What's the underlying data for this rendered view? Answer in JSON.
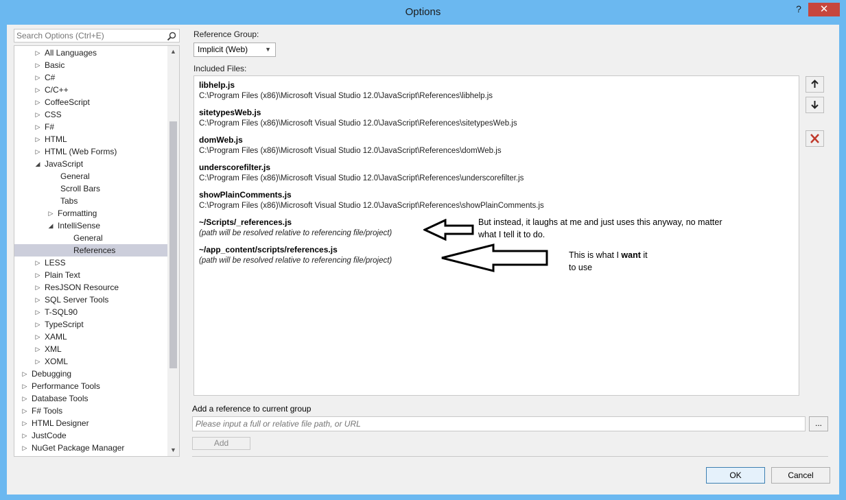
{
  "window": {
    "title": "Options",
    "help_label": "?",
    "close_label": "✕"
  },
  "search": {
    "placeholder": "Search Options (Ctrl+E)"
  },
  "tree": {
    "items": [
      {
        "label": "All Languages",
        "caret": "right"
      },
      {
        "label": "Basic",
        "caret": "right"
      },
      {
        "label": "C#",
        "caret": "right"
      },
      {
        "label": "C/C++",
        "caret": "right"
      },
      {
        "label": "CoffeeScript",
        "caret": "right"
      },
      {
        "label": "CSS",
        "caret": "right"
      },
      {
        "label": "F#",
        "caret": "right"
      },
      {
        "label": "HTML",
        "caret": "right"
      },
      {
        "label": "HTML (Web Forms)",
        "caret": "right"
      },
      {
        "label": "JavaScript",
        "caret": "down"
      },
      {
        "label": "General",
        "caret": "none"
      },
      {
        "label": "Scroll Bars",
        "caret": "none"
      },
      {
        "label": "Tabs",
        "caret": "none"
      },
      {
        "label": "Formatting",
        "caret": "right"
      },
      {
        "label": "IntelliSense",
        "caret": "down"
      },
      {
        "label": "General",
        "caret": "none"
      },
      {
        "label": "References",
        "caret": "none",
        "selected": true
      },
      {
        "label": "LESS",
        "caret": "right"
      },
      {
        "label": "Plain Text",
        "caret": "right"
      },
      {
        "label": "ResJSON Resource",
        "caret": "right"
      },
      {
        "label": "SQL Server Tools",
        "caret": "right"
      },
      {
        "label": "T-SQL90",
        "caret": "right"
      },
      {
        "label": "TypeScript",
        "caret": "right"
      },
      {
        "label": "XAML",
        "caret": "right"
      },
      {
        "label": "XML",
        "caret": "right"
      },
      {
        "label": "XOML",
        "caret": "right"
      },
      {
        "label": "Debugging",
        "caret": "right"
      },
      {
        "label": "Performance Tools",
        "caret": "right"
      },
      {
        "label": "Database Tools",
        "caret": "right"
      },
      {
        "label": "F# Tools",
        "caret": "right"
      },
      {
        "label": "HTML Designer",
        "caret": "right"
      },
      {
        "label": "JustCode",
        "caret": "right"
      },
      {
        "label": "NuGet Package Manager",
        "caret": "right"
      }
    ]
  },
  "reference_group": {
    "label": "Reference Group:",
    "value": "Implicit (Web)"
  },
  "included_files": {
    "label": "Included Files:",
    "files": [
      {
        "name": "libhelp.js",
        "path": "C:\\Program Files (x86)\\Microsoft Visual Studio 12.0\\JavaScript\\References\\libhelp.js"
      },
      {
        "name": "sitetypesWeb.js",
        "path": "C:\\Program Files (x86)\\Microsoft Visual Studio 12.0\\JavaScript\\References\\sitetypesWeb.js"
      },
      {
        "name": "domWeb.js",
        "path": "C:\\Program Files (x86)\\Microsoft Visual Studio 12.0\\JavaScript\\References\\domWeb.js"
      },
      {
        "name": "underscorefilter.js",
        "path": "C:\\Program Files (x86)\\Microsoft Visual Studio 12.0\\JavaScript\\References\\underscorefilter.js"
      },
      {
        "name": "showPlainComments.js",
        "path": "C:\\Program Files (x86)\\Microsoft Visual Studio 12.0\\JavaScript\\References\\showPlainComments.js"
      },
      {
        "name": "~/Scripts/_references.js",
        "path": "(path will be resolved relative to referencing file/project)"
      },
      {
        "name": "~/app_content/scripts/references.js",
        "path": "(path will be resolved relative to referencing file/project)"
      }
    ]
  },
  "annotations": {
    "first_line1": "But instead, it laughs at me and just uses this anyway, no matter",
    "first_line2": "what I tell it to do.",
    "second_pre": "This is what I ",
    "second_bold": "want",
    "second_post": " it",
    "second_line2": "to use"
  },
  "add_reference": {
    "label": "Add a reference to current group",
    "placeholder": "Please input a full or relative file path, or URL",
    "browse_label": "...",
    "add_label": "Add"
  },
  "buttons": {
    "ok": "OK",
    "cancel": "Cancel"
  },
  "colors": {
    "titlebar": "#6bb8f0",
    "close": "#c7463d",
    "selected": "#cccedb",
    "delete": "#c0392b"
  }
}
